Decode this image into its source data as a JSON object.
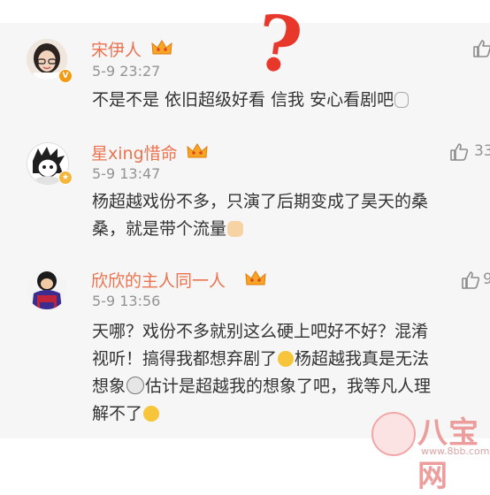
{
  "annotation": {
    "question_mark": "?"
  },
  "comments": [
    {
      "user": "宋伊人",
      "time": "5-9 23:27",
      "lines": [
        "不是不是 依旧超级好看 信我 安心看剧吧"
      ],
      "verified": "V",
      "like_count": ""
    },
    {
      "user": "星xing惜命",
      "time": "5-9 13:47",
      "lines": [
        "杨超越戏份不多，只演了后期变成了昊天的桑",
        "桑，就是带个流量"
      ],
      "like_count": "33"
    },
    {
      "user": "欣欣的主人同一人",
      "time": "5-9 13:56",
      "lines": [
        "天哪？戏份不多就别这么硬上吧好不好？混淆",
        "视听！搞得我都想弃剧了",
        "杨超越我真是无法",
        "想象",
        "估计是超越我的想象了吧，我等凡人理",
        "解不了"
      ],
      "like_count": "9"
    }
  ],
  "watermark": {
    "text": "八宝网",
    "url": "www.8bb.com"
  },
  "colors": {
    "name": "#eb7350",
    "meta": "#939393",
    "body": "#333333",
    "accent": "#e8382c",
    "badge": "#f19a12"
  },
  "icons": [
    "crown-icon",
    "thumb-up-icon",
    "emoji-icon",
    "verified-badge-icon"
  ]
}
